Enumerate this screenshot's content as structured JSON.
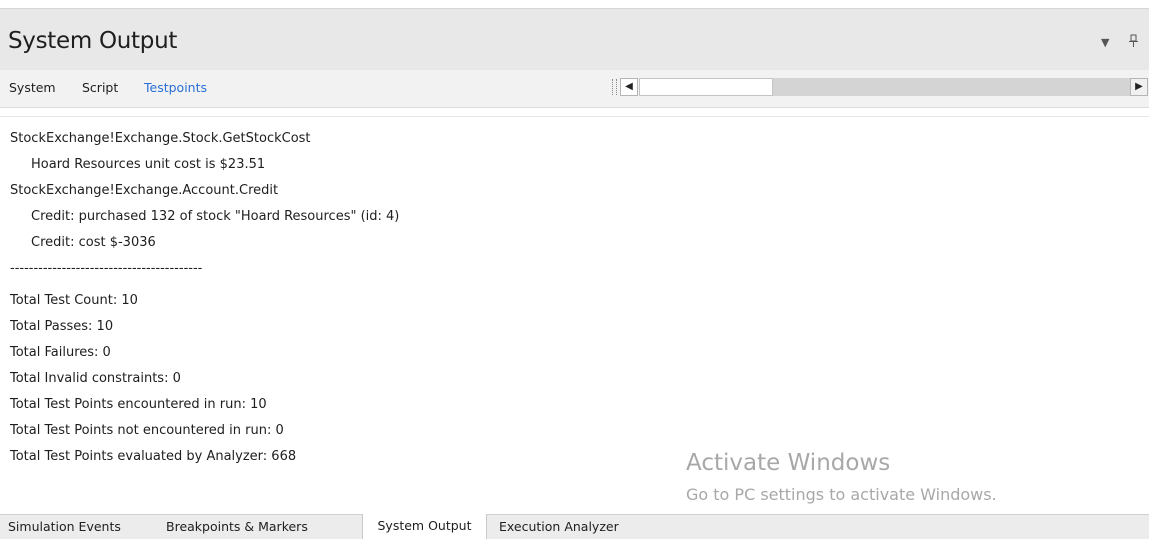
{
  "panel": {
    "title": "System Output",
    "dropdown_icon": "chevron-down-icon",
    "pin_icon": "pin-icon"
  },
  "tabs": [
    {
      "label": "System",
      "active": false
    },
    {
      "label": "Script",
      "active": false
    },
    {
      "label": "Testpoints",
      "active": true
    }
  ],
  "scrollbar": {
    "left_arrow": "◀",
    "right_arrow": "▶"
  },
  "output": {
    "lines": [
      {
        "text": "StockExchange!Exchange.Stock.GetStockCost",
        "indent": false
      },
      {
        "text": "Hoard Resources unit cost is $23.51",
        "indent": true
      },
      {
        "text": "StockExchange!Exchange.Account.Credit",
        "indent": false
      },
      {
        "text": "Credit: purchased 132 of stock \"Hoard Resources\" (id: 4)",
        "indent": true
      },
      {
        "text": "Credit: cost $-3036",
        "indent": true
      },
      {
        "text": "-----------------------------------------",
        "indent": false
      },
      {
        "text": "Total Test Count: 10",
        "indent": false
      },
      {
        "text": "Total Passes: 10",
        "indent": false
      },
      {
        "text": "Total Failures: 0",
        "indent": false
      },
      {
        "text": "Total Invalid constraints: 0",
        "indent": false
      },
      {
        "text": "Total Test Points encountered in run: 10",
        "indent": false
      },
      {
        "text": "Total Test Points not encountered in run: 0",
        "indent": false
      },
      {
        "text": "Total Test Points evaluated by Analyzer: 668",
        "indent": false
      }
    ]
  },
  "watermark": {
    "title": "Activate Windows",
    "subtitle": "Go to PC settings to activate Windows."
  },
  "bottom_tabs": [
    {
      "label": "Simulation Events",
      "active": false
    },
    {
      "label": "Breakpoints & Markers",
      "active": false
    },
    {
      "label": "System Output",
      "active": true
    },
    {
      "label": "Execution Analyzer",
      "active": false
    }
  ],
  "colors": {
    "active_tab": "#2a6fd6",
    "title_bar": "#e8e8e8",
    "watermark": "#a8a8a8"
  }
}
